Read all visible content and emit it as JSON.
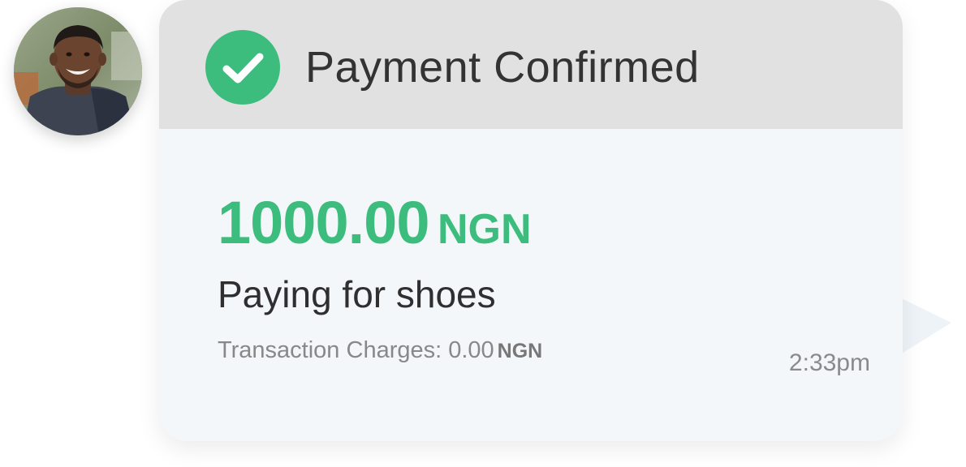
{
  "sender": {
    "avatar_alt": "sender photo"
  },
  "message": {
    "header": {
      "title": "Payment Confirmed",
      "status_icon": "check-circle-icon"
    },
    "amount": {
      "value": "1000.00",
      "currency": "NGN"
    },
    "description": "Paying for shoes",
    "charges": {
      "label": "Transaction Charges: 0.00",
      "currency": "NGN"
    },
    "timestamp": "2:33pm"
  },
  "colors": {
    "accent": "#3dbd7d",
    "header_bg": "#e1e1e1",
    "card_bg": "#f3f7fa",
    "title_text": "#333333",
    "muted_text": "#888888"
  }
}
